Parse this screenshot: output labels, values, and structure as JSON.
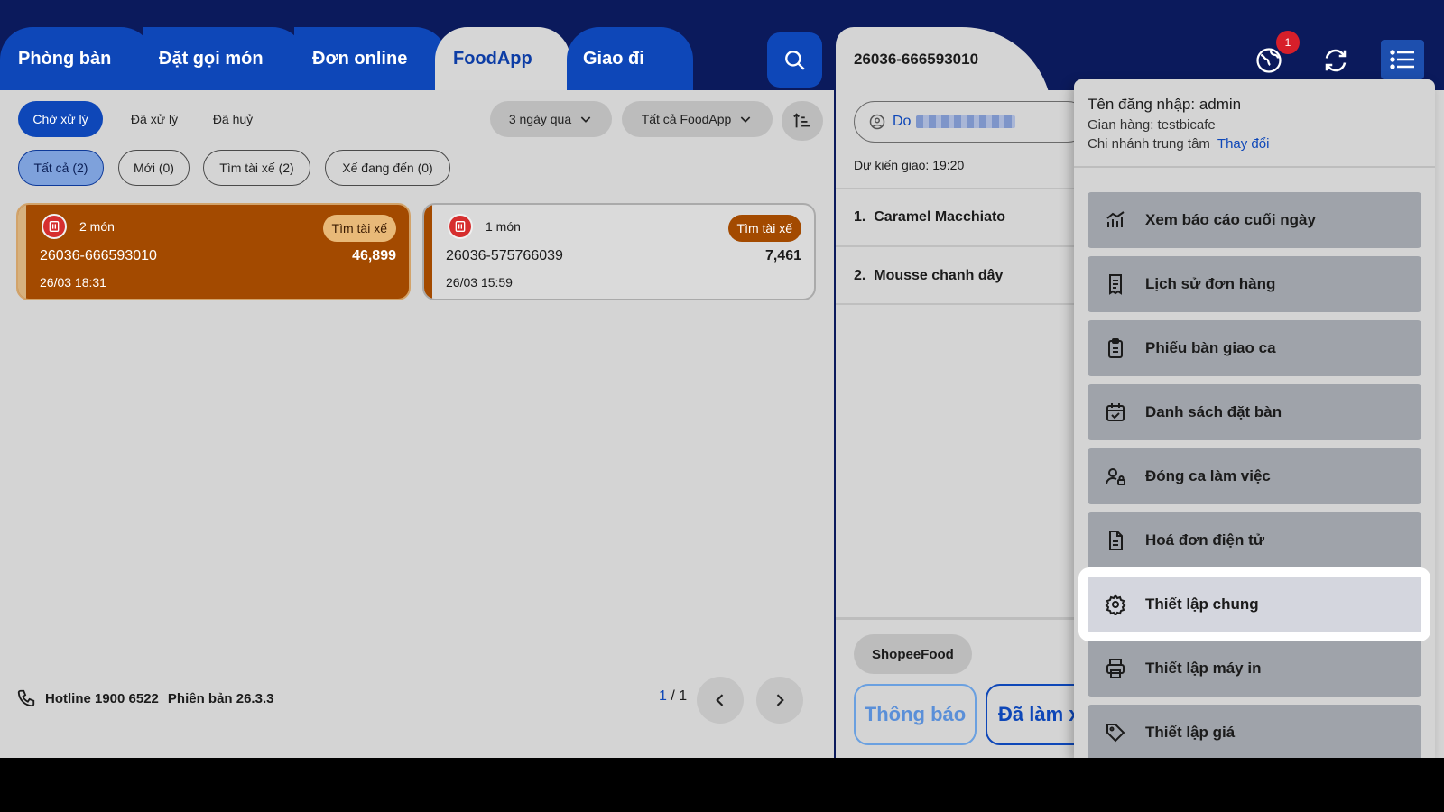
{
  "tabs": [
    {
      "label": "Phòng bàn"
    },
    {
      "label": "Đặt gọi món"
    },
    {
      "label": "Đơn online"
    },
    {
      "label": "FoodApp",
      "active": true
    },
    {
      "label": "Giao đi"
    }
  ],
  "filters": {
    "status": [
      {
        "label": "Chờ xử lý",
        "active": true
      },
      {
        "label": "Đã xử lý"
      },
      {
        "label": "Đã huỷ"
      }
    ],
    "date_range": "3 ngày qua",
    "app_source": "Tất cả FoodApp",
    "driver": [
      {
        "label": "Tất cả (2)",
        "active": true
      },
      {
        "label": "Mới (0)"
      },
      {
        "label": "Tìm tài xế (2)"
      },
      {
        "label": "Xế đang đến (0)"
      }
    ]
  },
  "orders": [
    {
      "items": "2 món",
      "status": "Tìm tài xế",
      "code": "26036-666593010",
      "amount": "46,899",
      "time": "26/03 18:31",
      "selected": true
    },
    {
      "items": "1 món",
      "status": "Tìm tài xế",
      "code": "26036-575766039",
      "amount": "7,461",
      "time": "26/03 15:59",
      "selected": false
    }
  ],
  "footer": {
    "hotline": "Hotline 1900 6522",
    "version": "Phiên bản 26.3.3",
    "page_current": "1",
    "page_sep": " / ",
    "page_total": "1"
  },
  "detail": {
    "order_code": "26036-666593010",
    "customer_prefix": "Do",
    "eta_label": "Dự kiến giao:",
    "eta_time": "19:20",
    "items": [
      {
        "index": "1.",
        "name": "Caramel Macchiato"
      },
      {
        "index": "2.",
        "name": "Mousse chanh dây"
      }
    ],
    "platform": "ShopeeFood",
    "btn_notify": "Thông báo",
    "btn_done": "Đã làm x"
  },
  "notification_count": "1",
  "account": {
    "username_line": "Tên đăng nhập: admin",
    "store_line": "Gian hàng: testbicafe",
    "branch": "Chi nhánh trung tâm",
    "change_label": "Thay đổi"
  },
  "menu": [
    {
      "label": "Xem báo cáo cuối ngày",
      "icon": "report-chart-icon"
    },
    {
      "label": "Lịch sử đơn hàng",
      "icon": "receipt-icon"
    },
    {
      "label": "Phiếu bàn giao ca",
      "icon": "clipboard-icon"
    },
    {
      "label": "Danh sách đặt bàn",
      "icon": "calendar-check-icon"
    },
    {
      "label": "Đóng ca làm việc",
      "icon": "user-lock-icon"
    },
    {
      "label": "Hoá đơn điện tử",
      "icon": "document-icon"
    },
    {
      "label": "Thiết lập chung",
      "icon": "gear-icon",
      "highlighted": true
    },
    {
      "label": "Thiết lập máy in",
      "icon": "printer-icon"
    },
    {
      "label": "Thiết lập giá",
      "icon": "price-tag-icon"
    }
  ],
  "colors": {
    "navy": "#0b1a5c",
    "primary_blue": "#0e47b8",
    "selected_card": "#a34a00"
  }
}
